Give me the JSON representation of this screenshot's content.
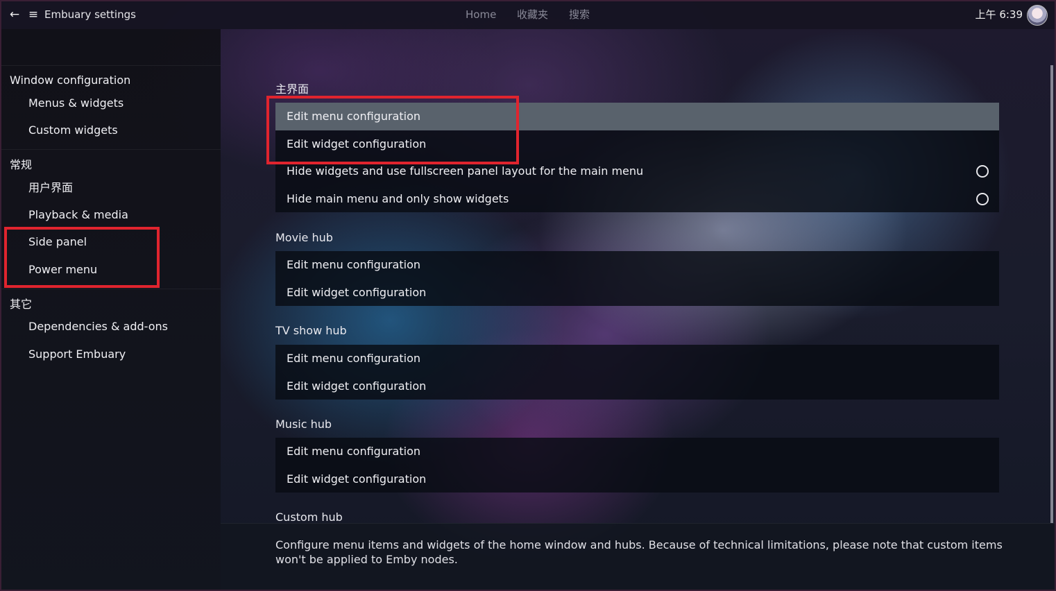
{
  "topbar": {
    "title": "Embuary settings",
    "nav": [
      "Home",
      "收藏夹",
      "搜索"
    ],
    "time": "上午 6:39"
  },
  "sidebar": {
    "sections": [
      {
        "header": "Window configuration",
        "items": [
          "Menus & widgets",
          "Custom widgets"
        ]
      },
      {
        "header": "常规",
        "items": [
          "用户界面",
          "Playback & media",
          "Side panel",
          "Power menu"
        ]
      },
      {
        "header": "其它",
        "items": [
          "Dependencies & add-ons",
          "Support Embuary"
        ]
      }
    ]
  },
  "groups": [
    {
      "label": "主界面",
      "rows": [
        "Edit menu configuration",
        "Edit widget configuration",
        "Hide widgets and use fullscreen panel layout for the main menu",
        "Hide main menu and only show widgets"
      ]
    },
    {
      "label": "Movie hub",
      "rows": [
        "Edit menu configuration",
        "Edit widget configuration"
      ]
    },
    {
      "label": "TV show hub",
      "rows": [
        "Edit menu configuration",
        "Edit widget configuration"
      ]
    },
    {
      "label": "Music hub",
      "rows": [
        "Edit menu configuration",
        "Edit widget configuration"
      ]
    },
    {
      "label": "Custom hub",
      "rows": []
    }
  ],
  "toggles": {
    "hide_widgets_fullscreen": false,
    "hide_main_menu": false
  },
  "description": "Configure menu items and widgets of the home window and hubs. Because of technical limitations, please note that custom items won't be applied to Emby nodes.",
  "icons": {
    "back": "arrow-left-icon",
    "menu": "hamburger-icon"
  },
  "colors": {
    "highlight_border": "#e0242e",
    "focused_row": "#59626c"
  }
}
